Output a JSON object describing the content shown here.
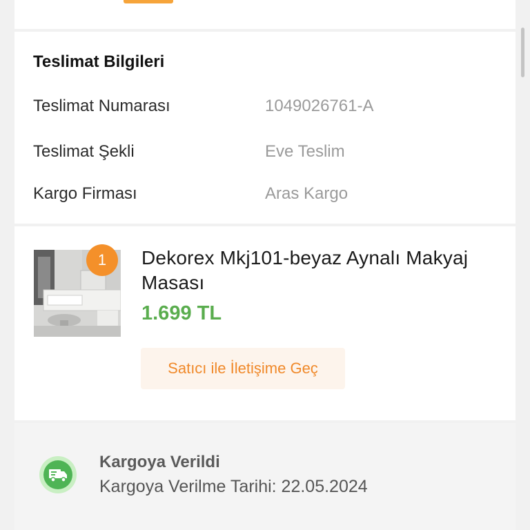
{
  "delivery": {
    "title": "Teslimat Bilgileri",
    "rows": [
      {
        "label": "Teslimat Numarası",
        "value": "1049026761-A"
      },
      {
        "label": "Teslimat Şekli",
        "value": "Eve Teslim"
      },
      {
        "label": "Kargo Firması",
        "value": "Aras Kargo"
      }
    ]
  },
  "product": {
    "quantity": "1",
    "name": "Dekorex Mkj101-beyaz Aynalı Makyaj Masası",
    "price": "1.699 TL",
    "contact_label": "Satıcı ile İletişime Geç"
  },
  "status": {
    "title": "Kargoya Verildi",
    "date_text": "Kargoya Verilme Tarihi: 22.05.2024",
    "icon": "delivery-truck-icon"
  },
  "colors": {
    "accent": "#f4902a",
    "price": "#5aad4e",
    "status_green": "#4fb455"
  }
}
